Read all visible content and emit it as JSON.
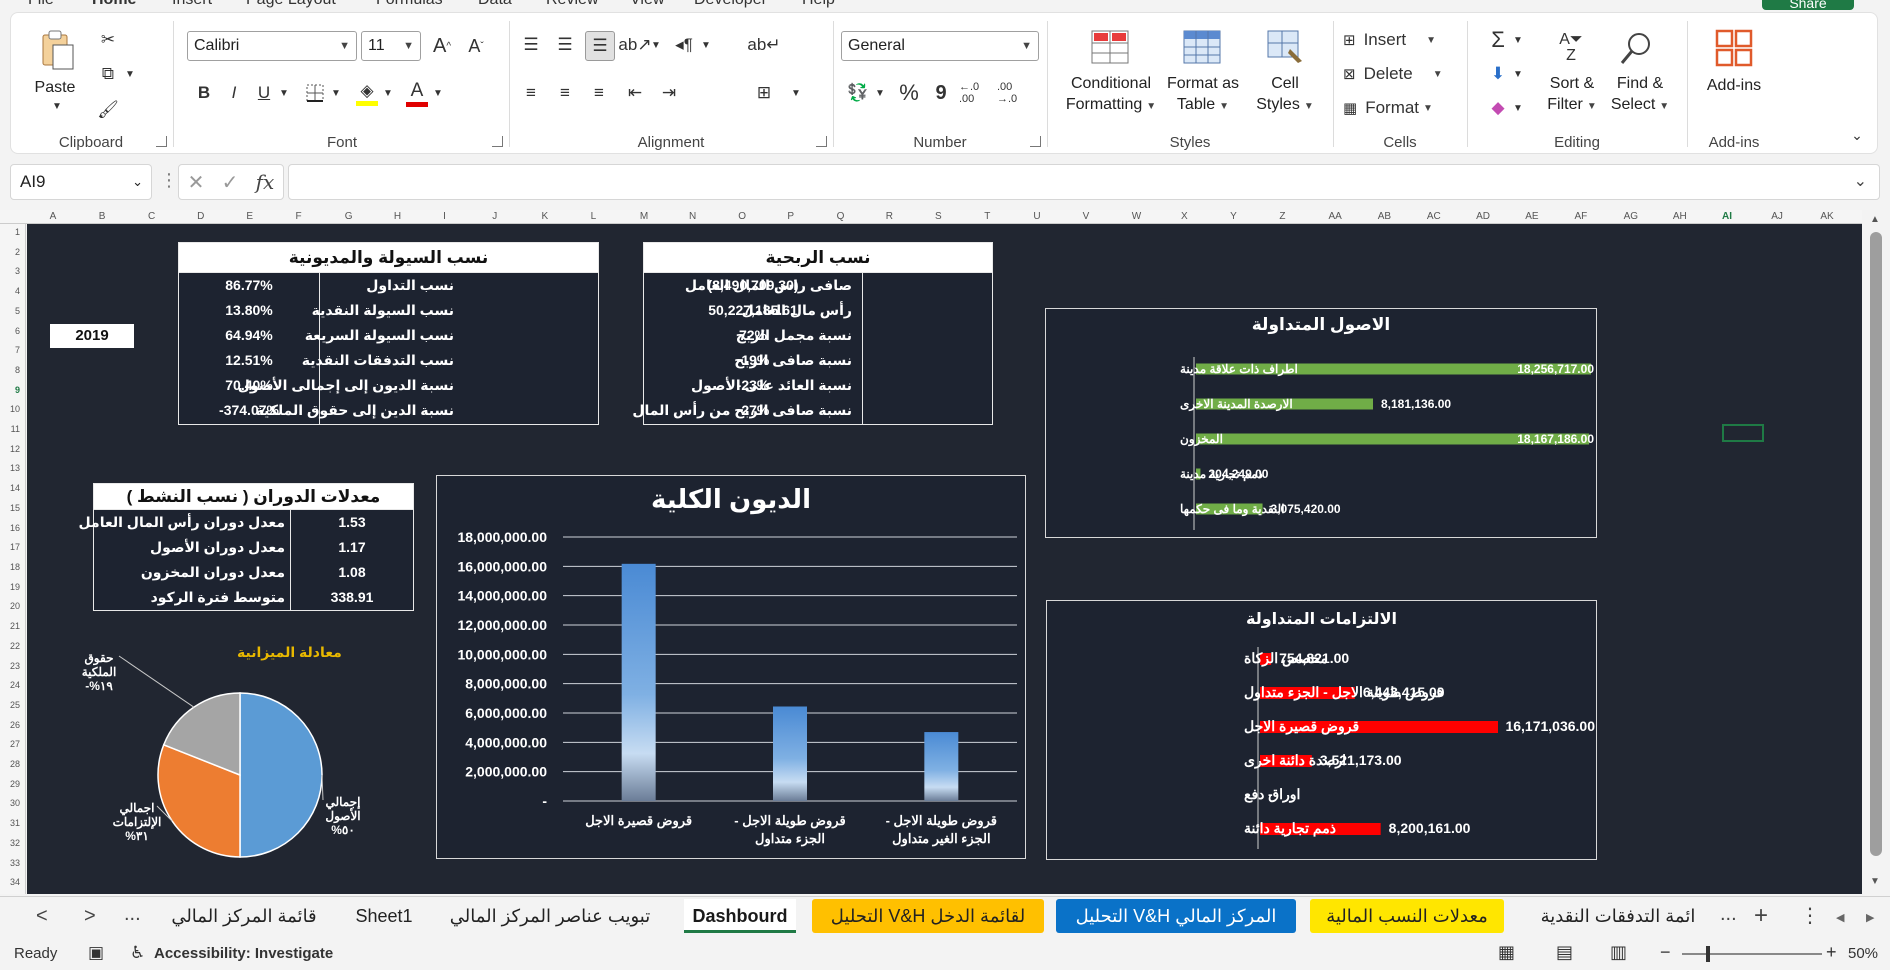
{
  "menu": [
    "File",
    "Home",
    "Insert",
    "Page Layout",
    "Formulas",
    "Data",
    "Review",
    "View",
    "Developer",
    "Help"
  ],
  "share_label": "Share",
  "ribbon": {
    "clipboard": {
      "label": "Clipboard",
      "paste": "Paste"
    },
    "font": {
      "label": "Font",
      "name": "Calibri",
      "size": "11",
      "bold": "B",
      "italic": "I",
      "underline": "U"
    },
    "alignment": {
      "label": "Alignment"
    },
    "number": {
      "label": "Number",
      "format": "General",
      "percent": "%",
      "comma": "9",
      "inc_decimal": "←.0 .00",
      "dec_decimal": ".00 →.0"
    },
    "styles": {
      "label": "Styles",
      "conditional_line1": "Conditional",
      "conditional_line2": "Formatting",
      "format_table_line1": "Format as",
      "format_table_line2": "Table",
      "cell_styles_line1": "Cell",
      "cell_styles_line2": "Styles"
    },
    "cells": {
      "label": "Cells",
      "insert": "Insert",
      "delete": "Delete",
      "format": "Format"
    },
    "editing": {
      "label": "Editing",
      "sort_line1": "Sort &",
      "sort_line2": "Filter",
      "find_line1": "Find &",
      "find_line2": "Select"
    },
    "addins": {
      "label": "Add-ins",
      "button": "Add-ins"
    }
  },
  "formula_bar": {
    "name_box": "AI9",
    "fx": "fx",
    "value": ""
  },
  "columns": [
    "A",
    "B",
    "C",
    "D",
    "E",
    "F",
    "G",
    "H",
    "I",
    "J",
    "K",
    "L",
    "M",
    "N",
    "O",
    "P",
    "Q",
    "R",
    "S",
    "T",
    "U",
    "V",
    "W",
    "X",
    "Y",
    "Z",
    "AA",
    "AB",
    "AC",
    "AD",
    "AE",
    "AF",
    "AG",
    "AH",
    "AI",
    "AJ",
    "AK"
  ],
  "rows": [
    "1",
    "2",
    "3",
    "4",
    "5",
    "6",
    "7",
    "8",
    "9",
    "10",
    "11",
    "12",
    "13",
    "14",
    "15",
    "16",
    "17",
    "18",
    "19",
    "20",
    "21",
    "22",
    "23",
    "24",
    "25",
    "26",
    "27",
    "28",
    "29",
    "30",
    "31",
    "32",
    "33",
    "34"
  ],
  "dashboard": {
    "year": "2019",
    "liquidity": {
      "title": "نسب السيولة والمديونية",
      "rows": [
        {
          "label": "نسب التداول",
          "value": "86.77%"
        },
        {
          "label": "نسب السيولة النقدية",
          "value": "13.80%"
        },
        {
          "label": "نسب السيولة السريعة",
          "value": "64.94%"
        },
        {
          "label": "نسب التدفقات النقدية",
          "value": "12.51%"
        },
        {
          "label": "نسبة الديون إلى إجمالى الأصول",
          "value": "70.40%"
        },
        {
          "label": "نسبة الدين إلى حقوق الملكية",
          "value": "-374.07%"
        }
      ]
    },
    "profitability": {
      "title": "نسب الربحية",
      "rows": [
        {
          "label": "صافى راس المال العامل",
          "value": "(8,490,709.30)"
        },
        {
          "label": "رأس مال العامل",
          "value": "50,227,185.61"
        },
        {
          "label": "نسبة مجمل الربح",
          "value": "72%"
        },
        {
          "label": "نسبة صافى الربح",
          "value": "-19%"
        },
        {
          "label": "نسبة العائد على الأصول",
          "value": "-23%"
        },
        {
          "label": "نسبة صافى الربح من رأس المال",
          "value": "-27%"
        }
      ]
    },
    "turnover": {
      "title": "معدلات الدوران ( نسب النشط )",
      "rows": [
        {
          "label": "معدل دوران رأس المال العامل",
          "value": "1.53"
        },
        {
          "label": "معدل دوران الأصول",
          "value": "1.17"
        },
        {
          "label": "معدل دوران المخزون",
          "value": "1.08"
        },
        {
          "label": "متوسط فترة الركود",
          "value": "338.91"
        }
      ]
    }
  },
  "chart_data": [
    {
      "id": "current-assets",
      "type": "bar",
      "orientation": "horizontal",
      "title": "الاصول المتداولة",
      "categories": [
        "اطراف ذات علاقة مدينة",
        "الارصدة المدينة الاخرى",
        "المخزون",
        "ذمم تجارية مدينة",
        "النقدية وما فى حكمها"
      ],
      "values": [
        18256717.0,
        8181136.0,
        18167186.0,
        204249.0,
        3075420.0
      ],
      "labels": [
        "18,256,717.00",
        "8,181,136.00",
        "18,167,186.00",
        "204,249.00",
        "3,075,420.00"
      ],
      "color": "#70ad47"
    },
    {
      "id": "current-liabilities",
      "type": "bar",
      "orientation": "horizontal",
      "title": "الالتزامات المتداولة",
      "categories": [
        "مخصص الزكاة",
        "قروض طويلة الاجل - الجزء متداول",
        "قروض قصيرة الاجل",
        "ارصدة دائنة اخرى",
        "اوراق دفع",
        "ذمم تجارية دائنة"
      ],
      "values": [
        754821.0,
        6443415.0,
        16171036.0,
        3521173.0,
        0,
        8200161.0
      ],
      "labels": [
        "754,821.00",
        "6,443,415.00",
        "16,171,036.00",
        "3,521,173.00",
        "-",
        "8,200,161.00"
      ],
      "color": "#ff0000"
    },
    {
      "id": "total-debt",
      "type": "bar",
      "title": "الديون الكلية",
      "categories": [
        "قروض قصيرة الاجل",
        "قروض طويلة الاجل - الجزء متداول",
        "قروض طويلة الاجل - الجزء الغير متداول"
      ],
      "values": [
        16171036.0,
        6443415.0,
        4700000.0
      ],
      "ylim": [
        0,
        18000000
      ],
      "yticks": [
        "-",
        "2,000,000.00",
        "4,000,000.00",
        "6,000,000.00",
        "8,000,000.00",
        "10,000,000.00",
        "12,000,000.00",
        "14,000,000.00",
        "16,000,000.00",
        "18,000,000.00"
      ],
      "color": "#5b9bd5"
    },
    {
      "id": "balance-equation",
      "type": "pie",
      "title": "معادلة الميزانية",
      "slices": [
        {
          "label": "إجمالي الأصول",
          "pct_label": "%٥٠",
          "value": 50,
          "color": "#5b9bd5"
        },
        {
          "label": "اجمالي الإلتزامات",
          "pct_label": "%٣١",
          "value": 31,
          "color": "#ed7d31"
        },
        {
          "label": "حقوق الملكية",
          "pct_label": "-%١٩",
          "value": 19,
          "color": "#a5a5a5"
        }
      ]
    }
  ],
  "sheet_tabs": {
    "nav_prev": "<",
    "nav_next": ">",
    "more": "...",
    "add": "+",
    "tabs": [
      {
        "label": "قائمة المركز المالي",
        "style": "plain"
      },
      {
        "label": "Sheet1",
        "style": "plain"
      },
      {
        "label": "تبويب عناصر المركز المالي",
        "style": "plain"
      },
      {
        "label": "Dashbourd",
        "style": "active"
      },
      {
        "label": "لقائمة الدخل V&H التحليل",
        "style": "orange"
      },
      {
        "label": "المركز المالي V&H التحليل",
        "style": "blue"
      },
      {
        "label": "معدلات النسب المالية",
        "style": "yellow"
      },
      {
        "label": "ائمة التدفقات النقدية",
        "style": "plain"
      }
    ]
  },
  "status": {
    "ready": "Ready",
    "accessibility": "Accessibility: Investigate",
    "zoom": "50%",
    "minus": "−",
    "plus": "+"
  }
}
